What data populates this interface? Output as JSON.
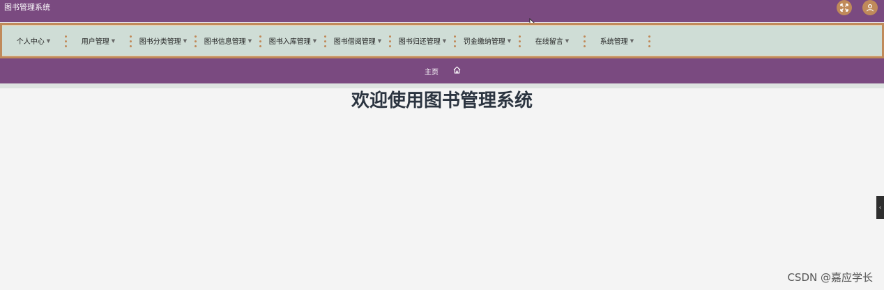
{
  "header": {
    "app_title": "图书管理系统"
  },
  "icons": {
    "fullscreen": "fullscreen-icon",
    "user": "user-icon",
    "home": "home-icon",
    "collapse": "chevron-left-icon"
  },
  "colors": {
    "header_bg": "#7a4a80",
    "nav_bg": "#cfddd6",
    "accent": "#c08a5a",
    "title_text": "#2b3440"
  },
  "nav": {
    "items": [
      {
        "label": "个人中心"
      },
      {
        "label": "用户管理"
      },
      {
        "label": "图书分类管理"
      },
      {
        "label": "图书信息管理"
      },
      {
        "label": "图书入库管理"
      },
      {
        "label": "图书借阅管理"
      },
      {
        "label": "图书归还管理"
      },
      {
        "label": "罚金缴纳管理"
      },
      {
        "label": "在线留言"
      },
      {
        "label": "系统管理"
      }
    ]
  },
  "breadcrumb": {
    "home_label": "主页"
  },
  "main": {
    "welcome_title": "欢迎使用图书管理系统"
  },
  "watermark": {
    "text": "CSDN @嘉应学长"
  }
}
